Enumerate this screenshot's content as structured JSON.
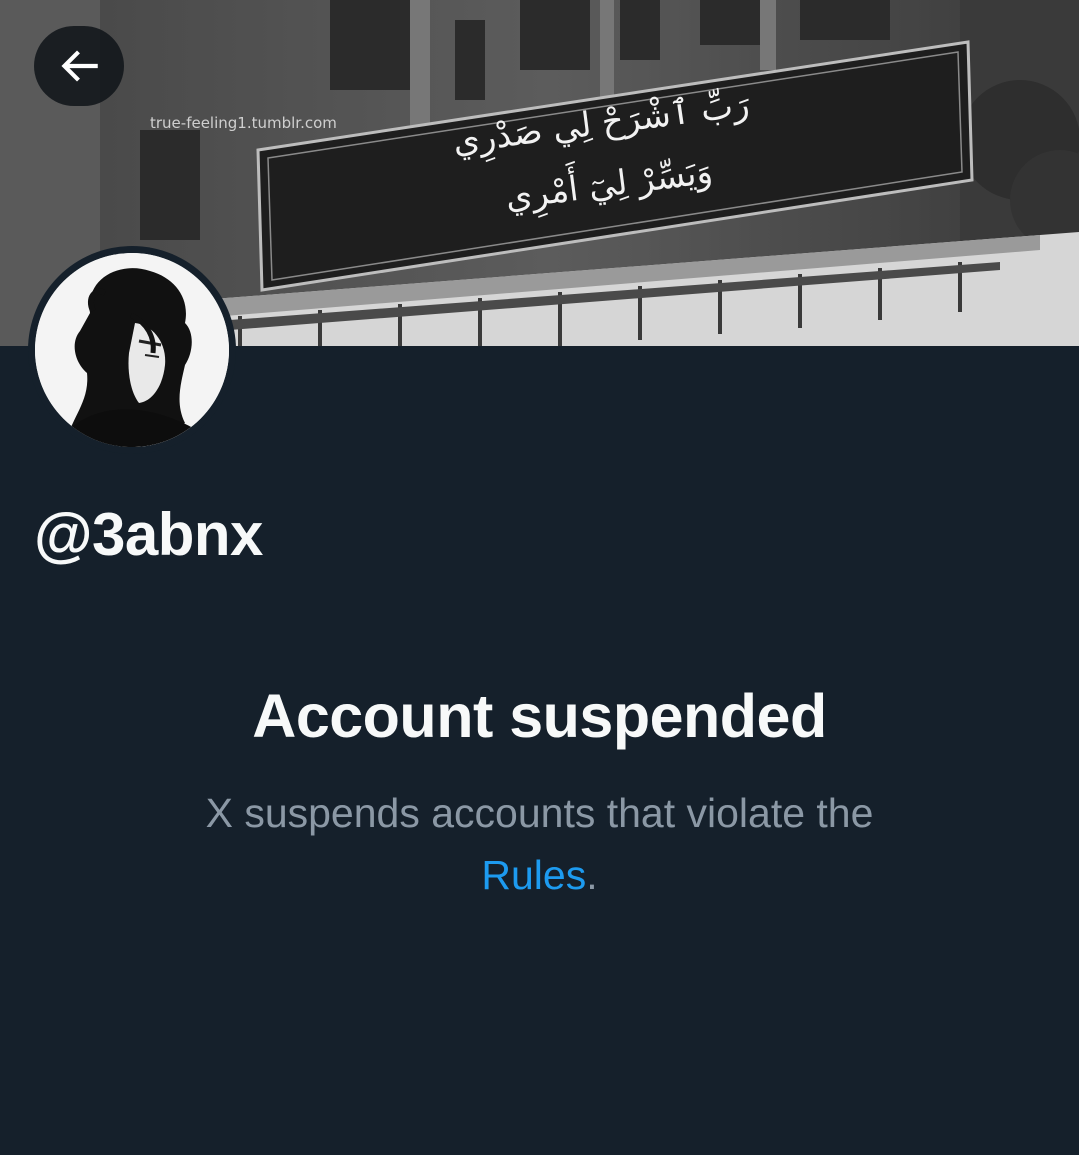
{
  "header": {
    "back_button_icon": "arrow-left-icon"
  },
  "banner": {
    "watermark": "true-feeling1.tumblr.com",
    "sign_text": "رَبِّ ٱشْرَحْ لِي صَدْرِي\nوَيَسِّرْ لِيٓ أَمْرِي"
  },
  "profile": {
    "handle": "@3abnx"
  },
  "suspension": {
    "title": "Account suspended",
    "description": "X suspends accounts that violate the",
    "link_text": "Rules",
    "trailing": "."
  },
  "colors": {
    "background": "#15202b",
    "primary_text": "#f7f9f9",
    "secondary_text": "#8b98a5",
    "link": "#1d9bf0"
  }
}
